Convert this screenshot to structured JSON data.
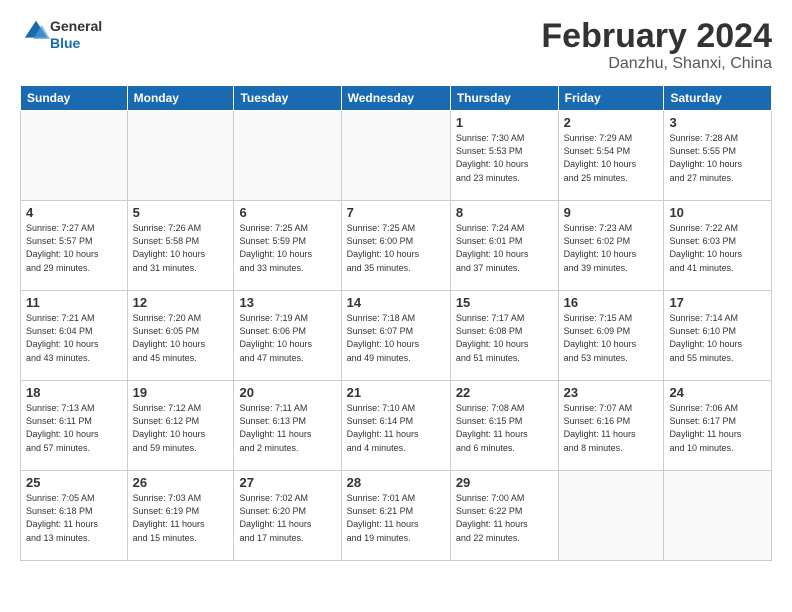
{
  "header": {
    "logo_general": "General",
    "logo_blue": "Blue",
    "month": "February 2024",
    "location": "Danzhu, Shanxi, China"
  },
  "days_of_week": [
    "Sunday",
    "Monday",
    "Tuesday",
    "Wednesday",
    "Thursday",
    "Friday",
    "Saturday"
  ],
  "weeks": [
    [
      {
        "num": "",
        "info": ""
      },
      {
        "num": "",
        "info": ""
      },
      {
        "num": "",
        "info": ""
      },
      {
        "num": "",
        "info": ""
      },
      {
        "num": "1",
        "info": "Sunrise: 7:30 AM\nSunset: 5:53 PM\nDaylight: 10 hours\nand 23 minutes."
      },
      {
        "num": "2",
        "info": "Sunrise: 7:29 AM\nSunset: 5:54 PM\nDaylight: 10 hours\nand 25 minutes."
      },
      {
        "num": "3",
        "info": "Sunrise: 7:28 AM\nSunset: 5:55 PM\nDaylight: 10 hours\nand 27 minutes."
      }
    ],
    [
      {
        "num": "4",
        "info": "Sunrise: 7:27 AM\nSunset: 5:57 PM\nDaylight: 10 hours\nand 29 minutes."
      },
      {
        "num": "5",
        "info": "Sunrise: 7:26 AM\nSunset: 5:58 PM\nDaylight: 10 hours\nand 31 minutes."
      },
      {
        "num": "6",
        "info": "Sunrise: 7:25 AM\nSunset: 5:59 PM\nDaylight: 10 hours\nand 33 minutes."
      },
      {
        "num": "7",
        "info": "Sunrise: 7:25 AM\nSunset: 6:00 PM\nDaylight: 10 hours\nand 35 minutes."
      },
      {
        "num": "8",
        "info": "Sunrise: 7:24 AM\nSunset: 6:01 PM\nDaylight: 10 hours\nand 37 minutes."
      },
      {
        "num": "9",
        "info": "Sunrise: 7:23 AM\nSunset: 6:02 PM\nDaylight: 10 hours\nand 39 minutes."
      },
      {
        "num": "10",
        "info": "Sunrise: 7:22 AM\nSunset: 6:03 PM\nDaylight: 10 hours\nand 41 minutes."
      }
    ],
    [
      {
        "num": "11",
        "info": "Sunrise: 7:21 AM\nSunset: 6:04 PM\nDaylight: 10 hours\nand 43 minutes."
      },
      {
        "num": "12",
        "info": "Sunrise: 7:20 AM\nSunset: 6:05 PM\nDaylight: 10 hours\nand 45 minutes."
      },
      {
        "num": "13",
        "info": "Sunrise: 7:19 AM\nSunset: 6:06 PM\nDaylight: 10 hours\nand 47 minutes."
      },
      {
        "num": "14",
        "info": "Sunrise: 7:18 AM\nSunset: 6:07 PM\nDaylight: 10 hours\nand 49 minutes."
      },
      {
        "num": "15",
        "info": "Sunrise: 7:17 AM\nSunset: 6:08 PM\nDaylight: 10 hours\nand 51 minutes."
      },
      {
        "num": "16",
        "info": "Sunrise: 7:15 AM\nSunset: 6:09 PM\nDaylight: 10 hours\nand 53 minutes."
      },
      {
        "num": "17",
        "info": "Sunrise: 7:14 AM\nSunset: 6:10 PM\nDaylight: 10 hours\nand 55 minutes."
      }
    ],
    [
      {
        "num": "18",
        "info": "Sunrise: 7:13 AM\nSunset: 6:11 PM\nDaylight: 10 hours\nand 57 minutes."
      },
      {
        "num": "19",
        "info": "Sunrise: 7:12 AM\nSunset: 6:12 PM\nDaylight: 10 hours\nand 59 minutes."
      },
      {
        "num": "20",
        "info": "Sunrise: 7:11 AM\nSunset: 6:13 PM\nDaylight: 11 hours\nand 2 minutes."
      },
      {
        "num": "21",
        "info": "Sunrise: 7:10 AM\nSunset: 6:14 PM\nDaylight: 11 hours\nand 4 minutes."
      },
      {
        "num": "22",
        "info": "Sunrise: 7:08 AM\nSunset: 6:15 PM\nDaylight: 11 hours\nand 6 minutes."
      },
      {
        "num": "23",
        "info": "Sunrise: 7:07 AM\nSunset: 6:16 PM\nDaylight: 11 hours\nand 8 minutes."
      },
      {
        "num": "24",
        "info": "Sunrise: 7:06 AM\nSunset: 6:17 PM\nDaylight: 11 hours\nand 10 minutes."
      }
    ],
    [
      {
        "num": "25",
        "info": "Sunrise: 7:05 AM\nSunset: 6:18 PM\nDaylight: 11 hours\nand 13 minutes."
      },
      {
        "num": "26",
        "info": "Sunrise: 7:03 AM\nSunset: 6:19 PM\nDaylight: 11 hours\nand 15 minutes."
      },
      {
        "num": "27",
        "info": "Sunrise: 7:02 AM\nSunset: 6:20 PM\nDaylight: 11 hours\nand 17 minutes."
      },
      {
        "num": "28",
        "info": "Sunrise: 7:01 AM\nSunset: 6:21 PM\nDaylight: 11 hours\nand 19 minutes."
      },
      {
        "num": "29",
        "info": "Sunrise: 7:00 AM\nSunset: 6:22 PM\nDaylight: 11 hours\nand 22 minutes."
      },
      {
        "num": "",
        "info": ""
      },
      {
        "num": "",
        "info": ""
      }
    ]
  ]
}
